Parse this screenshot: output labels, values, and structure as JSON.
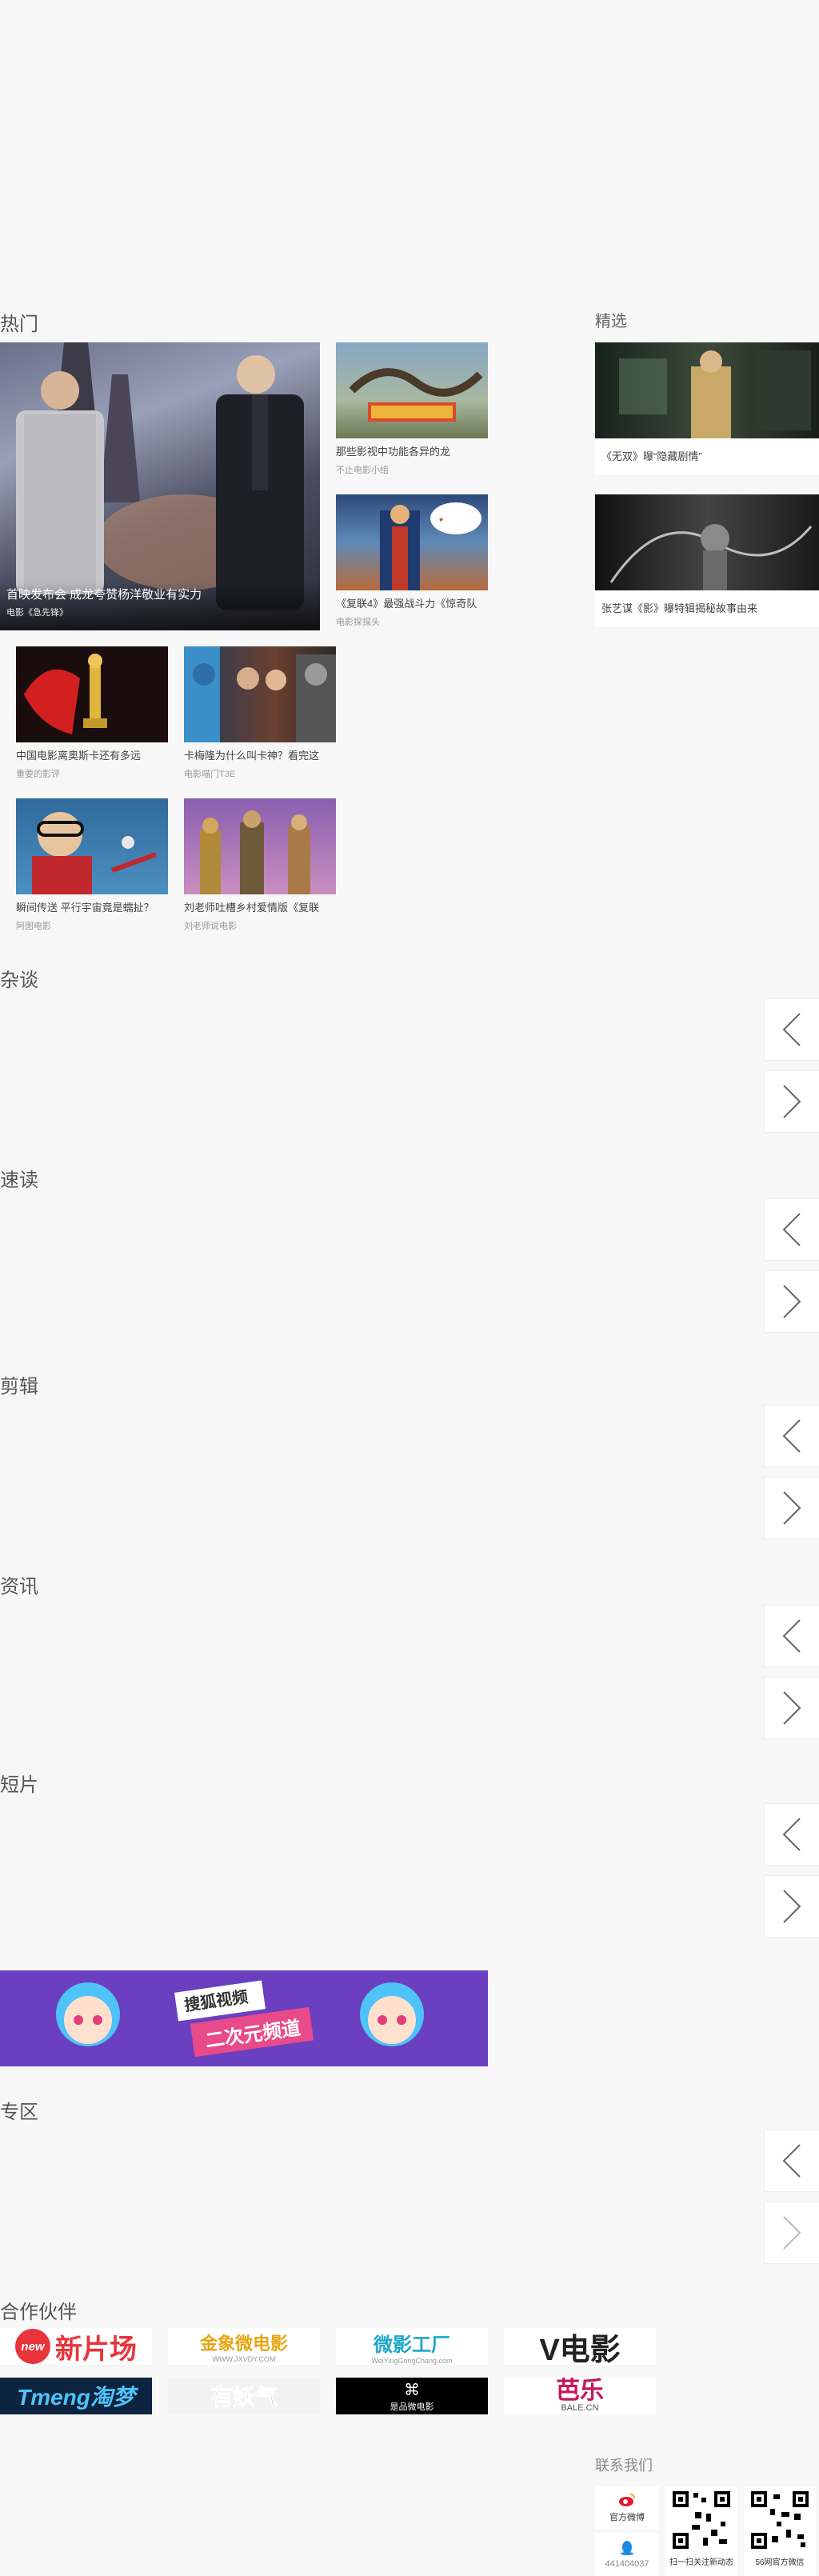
{
  "sections": {
    "hot": "热门",
    "featured": "精选",
    "talk": "杂谈",
    "quick": "速读",
    "edit": "剪辑",
    "news": "资讯",
    "short": "短片",
    "special": "专区",
    "partners": "合作伙伴",
    "contact": "联系我们"
  },
  "hot_main": {
    "title": "首映发布会 成龙夸赞杨洋敬业有实力",
    "sub": "电影《急先锋》"
  },
  "hot_side": [
    {
      "title": "那些影视中功能各异的龙",
      "sub": "不止电影小组"
    },
    {
      "title": "《复联4》最强战斗力《惊奇队",
      "sub": "电影探探头"
    }
  ],
  "hot_grid": [
    {
      "title": "中国电影离奥斯卡还有多远",
      "sub": "重要的影评"
    },
    {
      "title": "卡梅隆为什么叫卡神？看完这",
      "sub": "电影喵门T3E"
    },
    {
      "title": "瞬间传送 平行宇宙竟是蠕扯？",
      "sub": "阿图电影"
    },
    {
      "title": "刘老师吐槽乡村爱情版《复联",
      "sub": "刘老师说电影"
    }
  ],
  "featured": [
    {
      "title": "《无双》曝“隐藏剧情”"
    },
    {
      "title": "张艺谋《影》曝特辑揭秘故事由来"
    }
  ],
  "banner": {
    "small": "搜狐视频",
    "big": "二次元频道"
  },
  "partners": [
    {
      "name": "新片场",
      "badge": "new"
    },
    {
      "name": "金象微电影",
      "sub": "WWW.JXVDY.COM"
    },
    {
      "name": "微影工厂",
      "sub": "WeiYingGongChang.com"
    },
    {
      "name": "V电影"
    },
    {
      "name": "Tmeng淘梦"
    },
    {
      "name": "有妖气"
    },
    {
      "name": "是品微电影"
    },
    {
      "name": "芭乐",
      "sub": "BALE.CN"
    }
  ],
  "contact": {
    "weibo": "官方微博",
    "qq": "441404037",
    "qr1": "扫一扫关注新动态",
    "qr2": "56网官方微信"
  },
  "colors": {
    "banner_bg": "#6a3fc0",
    "partner_red": "#e8343b"
  }
}
